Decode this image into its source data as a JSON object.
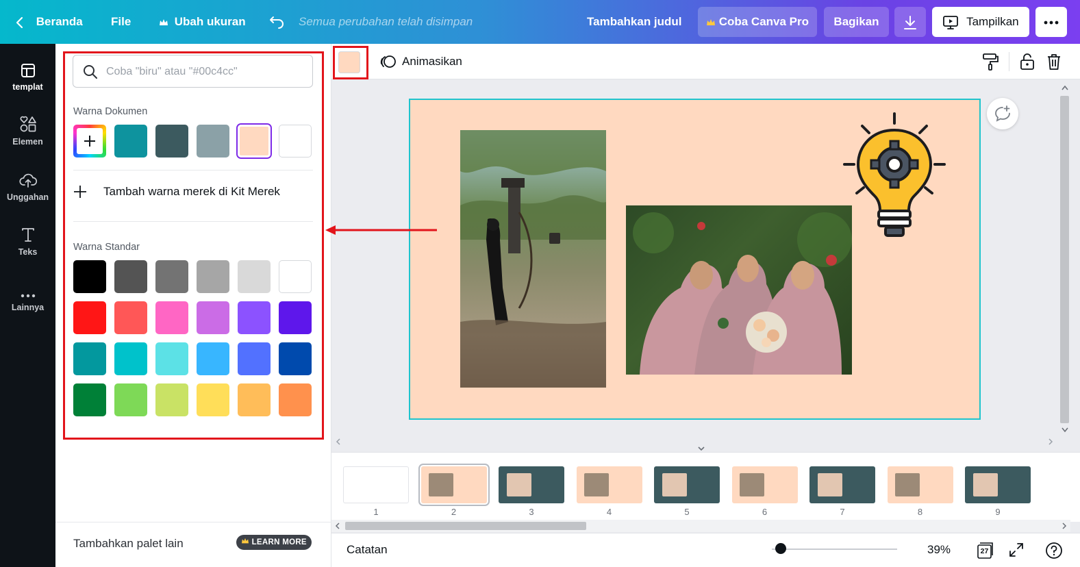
{
  "topbar": {
    "home": "Beranda",
    "file": "File",
    "resize": "Ubah ukuran",
    "saved_status": "Semua perubahan telah disimpan",
    "add_title": "Tambahkan judul",
    "try_pro": "Coba Canva Pro",
    "share": "Bagikan",
    "present": "Tampilkan"
  },
  "sidebar": {
    "items": [
      {
        "label": "templat",
        "icon": "template-icon"
      },
      {
        "label": "Elemen",
        "icon": "elements-icon"
      },
      {
        "label": "Unggahan",
        "icon": "upload-cloud-icon"
      },
      {
        "label": "Teks",
        "icon": "text-icon"
      },
      {
        "label": "Lainnya",
        "icon": "more-dots-icon"
      }
    ]
  },
  "color_panel": {
    "search_placeholder": "Coba \"biru\" atau \"#00c4cc\"",
    "document_colors_label": "Warna Dokumen",
    "document_colors": [
      "#0e939e",
      "#3c5a5f",
      "#8ba1a7",
      "#ffd9c0",
      "#ffffff"
    ],
    "selected_document_color": "#ffd9c0",
    "add_brand_label": "Tambah warna merek di Kit Merek",
    "standard_colors_label": "Warna Standar",
    "standard_colors": [
      [
        "#000000",
        "#545454",
        "#737373",
        "#a6a6a6",
        "#d9d9d9",
        "#ffffff"
      ],
      [
        "#ff1616",
        "#ff5757",
        "#ff66c4",
        "#cb6ce6",
        "#8c52ff",
        "#5e17eb"
      ],
      [
        "#03989e",
        "#00c2cb",
        "#5ce1e6",
        "#38b6ff",
        "#5271ff",
        "#004aad"
      ],
      [
        "#008037",
        "#7ed957",
        "#c9e265",
        "#ffde59",
        "#ffbd59",
        "#ff914d"
      ]
    ],
    "add_palette_label": "Tambahkan palet lain",
    "learn_more": "LEARN MORE"
  },
  "toolbar": {
    "current_color": "#ffd9c0",
    "animate": "Animasikan"
  },
  "canvas": {
    "background": "#ffd9c0"
  },
  "pages": {
    "numbers": [
      "1",
      "2",
      "3",
      "4",
      "5",
      "6",
      "7",
      "8",
      "9"
    ],
    "selected": "2"
  },
  "bottom": {
    "notes": "Catatan",
    "zoom": "39%",
    "zoom_fraction": 0.04,
    "page_count": "27"
  },
  "accent": {
    "highlight_red": "#e2141b",
    "selection_purple": "#7d2ae8",
    "canvas_border_teal": "#1fc4cc"
  }
}
